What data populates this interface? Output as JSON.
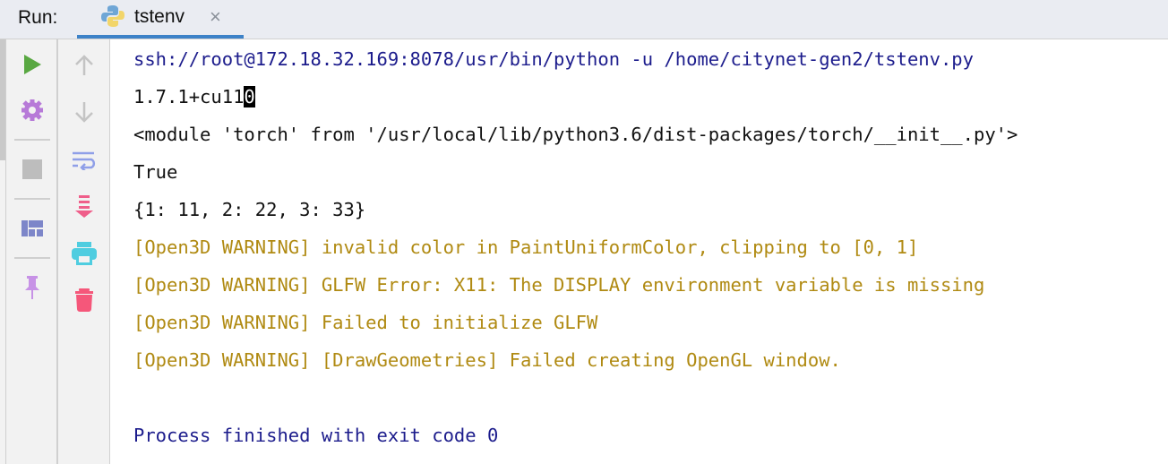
{
  "header": {
    "run_label": "Run:",
    "tab": {
      "name": "tstenv",
      "close": "×"
    }
  },
  "toolbar_left": [
    {
      "icon": "play-icon"
    },
    {
      "icon": "gear-icon"
    },
    {
      "icon": "stop-icon"
    },
    {
      "icon": "layout-icon"
    },
    {
      "icon": "pin-icon"
    }
  ],
  "toolbar_right": [
    {
      "icon": "arrow-up-icon"
    },
    {
      "icon": "arrow-down-icon"
    },
    {
      "icon": "soft-wrap-icon"
    },
    {
      "icon": "scroll-to-end-icon"
    },
    {
      "icon": "print-icon"
    },
    {
      "icon": "trash-icon"
    }
  ],
  "console": {
    "command": "ssh://root@172.18.32.169:8078/usr/bin/python -u /home/citynet-gen2/tstenv.py",
    "version_prefix": "1.7.1+cu11",
    "version_cursor_char": "0",
    "module": "<module 'torch' from '/usr/local/lib/python3.6/dist-packages/torch/__init__.py'>",
    "cuda": "True",
    "dict": "{1: 11, 2: 22, 3: 33}",
    "warnings": [
      "[Open3D WARNING] invalid color in PaintUniformColor, clipping to [0, 1]",
      "[Open3D WARNING] GLFW Error: X11: The DISPLAY environment variable is missing",
      "[Open3D WARNING] Failed to initialize GLFW",
      "[Open3D WARNING] [DrawGeometries] Failed creating OpenGL window."
    ],
    "exit": "Process finished with exit code 0"
  },
  "colors": {
    "command": "#1c1c8c",
    "warning": "#b08a12",
    "tab_underline": "#3d82c8"
  }
}
